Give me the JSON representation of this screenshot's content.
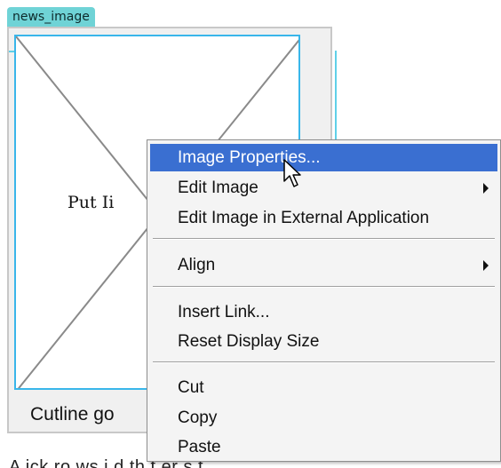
{
  "editor": {
    "region_tag": "news_image",
    "placeholder_text": "Put Ii",
    "cutline_text": "Cutline go",
    "bottom_text": "A  ick  ro  ws  i  d  th  t  er  s  t"
  },
  "context_menu": {
    "items": [
      {
        "label": "Image Properties...",
        "highlighted": true,
        "submenu": false
      },
      {
        "label": "Edit Image",
        "highlighted": false,
        "submenu": true
      },
      {
        "label": "Edit Image in External Application",
        "highlighted": false,
        "submenu": false
      },
      {
        "label": "Align",
        "highlighted": false,
        "submenu": true
      },
      {
        "label": "Insert Link...",
        "highlighted": false,
        "submenu": false
      },
      {
        "label": "Reset Display Size",
        "highlighted": false,
        "submenu": false
      },
      {
        "label": "Cut",
        "highlighted": false,
        "submenu": false
      },
      {
        "label": "Copy",
        "highlighted": false,
        "submenu": false
      },
      {
        "label": "Paste",
        "highlighted": false,
        "submenu": false
      }
    ]
  },
  "colors": {
    "highlight": "#3a6fd1",
    "tag_background": "#6fd3d6",
    "placeholder_border": "#39b6ea"
  },
  "icons": {
    "cursor": "arrow-pointer-icon",
    "submenu": "submenu-arrow-icon"
  }
}
